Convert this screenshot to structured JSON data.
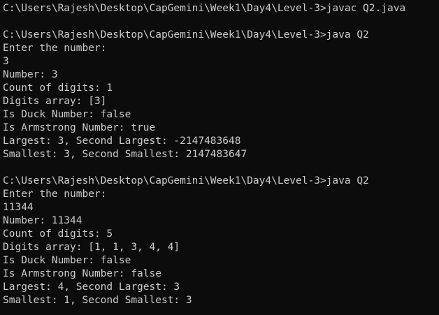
{
  "terminal": {
    "lines": [
      "C:\\Users\\Rajesh\\Desktop\\CapGemini\\Week1\\Day4\\Level-3>javac Q2.java",
      "",
      "C:\\Users\\Rajesh\\Desktop\\CapGemini\\Week1\\Day4\\Level-3>java Q2",
      "Enter the number:",
      "3",
      "Number: 3",
      "Count of digits: 1",
      "Digits array: [3]",
      "Is Duck Number: false",
      "Is Armstrong Number: true",
      "Largest: 3, Second Largest: -2147483648",
      "Smallest: 3, Second Smallest: 2147483647",
      "",
      "C:\\Users\\Rajesh\\Desktop\\CapGemini\\Week1\\Day4\\Level-3>java Q2",
      "Enter the number:",
      "11344",
      "Number: 11344",
      "Count of digits: 5",
      "Digits array: [1, 1, 3, 4, 4]",
      "Is Duck Number: false",
      "Is Armstrong Number: false",
      "Largest: 4, Second Largest: 3",
      "Smallest: 1, Second Smallest: 3"
    ]
  },
  "colors": {
    "background": "#0c0c0c",
    "foreground": "#cccccc"
  }
}
